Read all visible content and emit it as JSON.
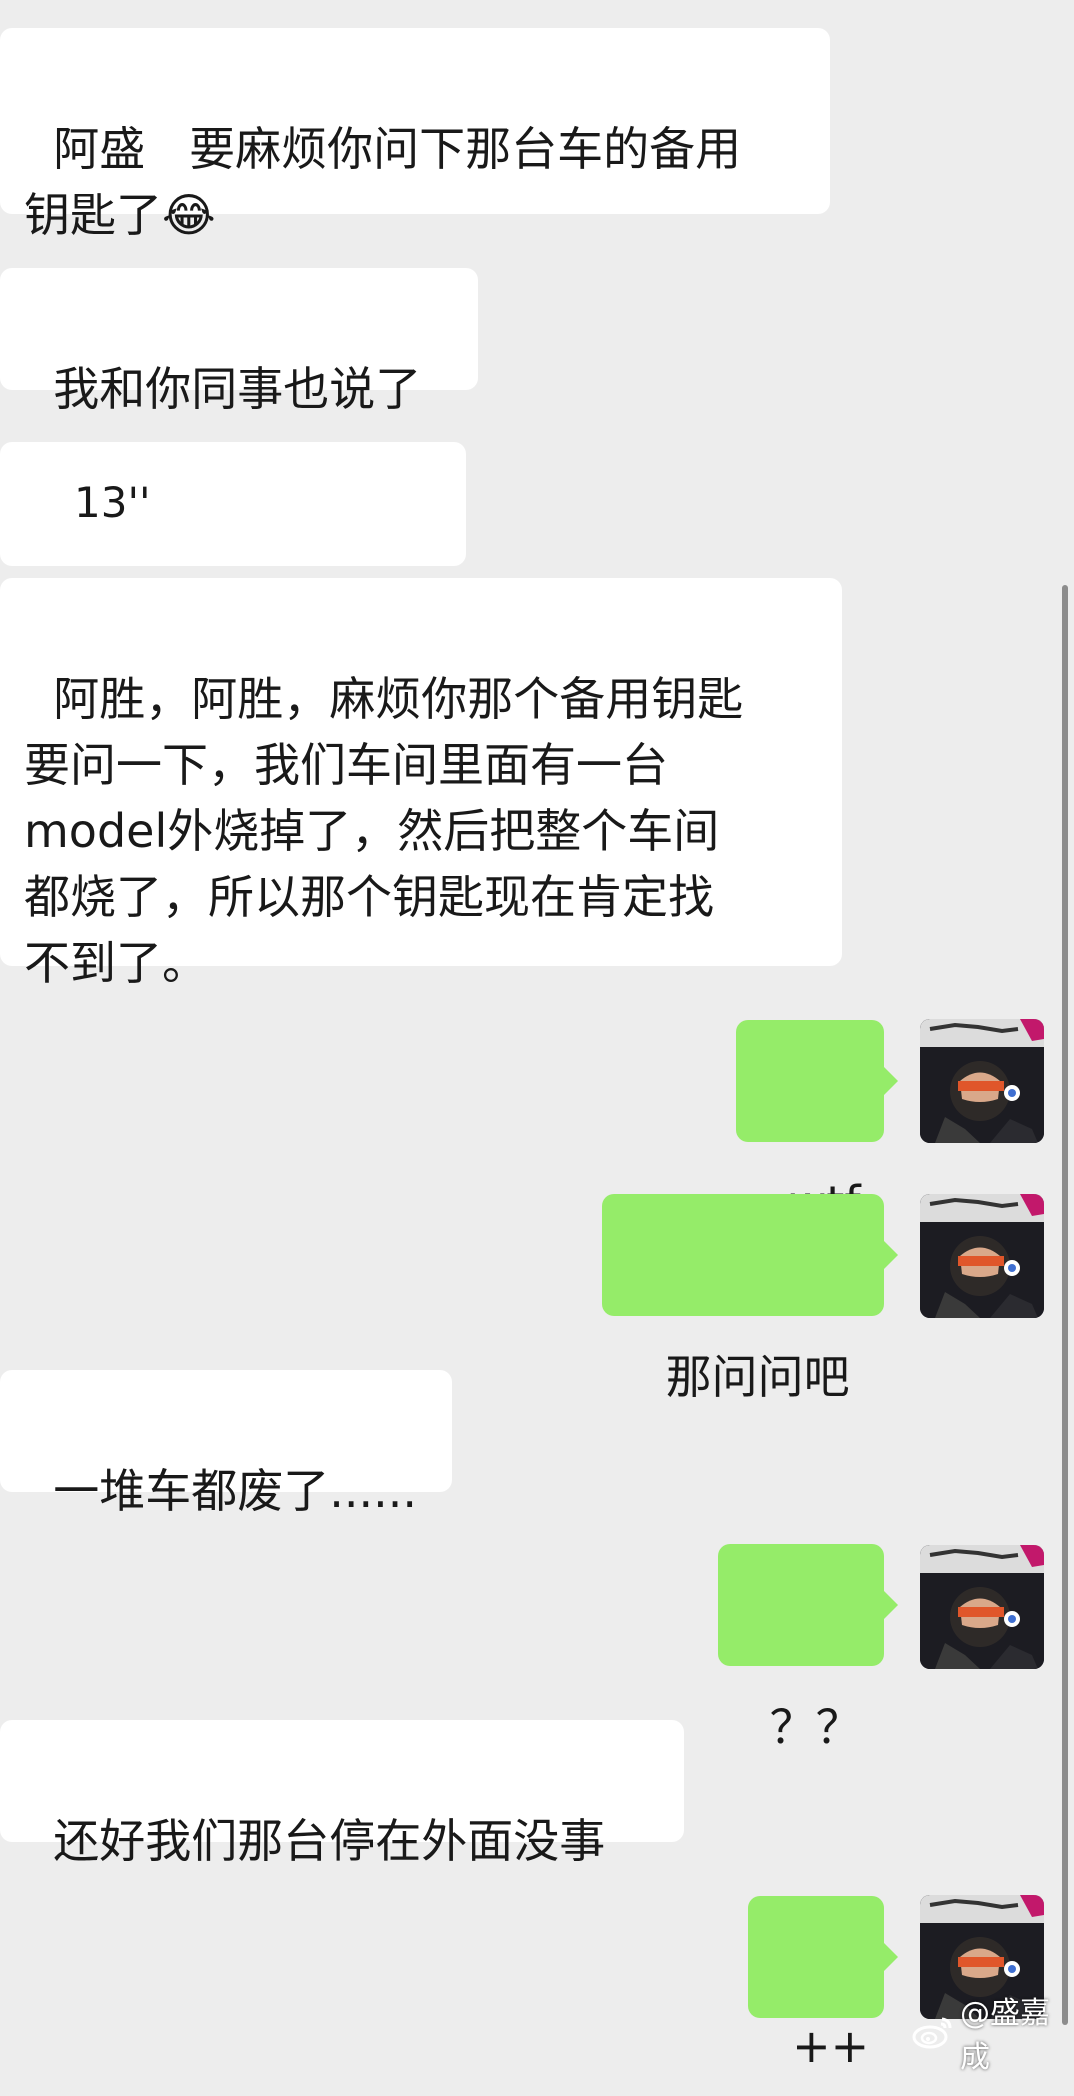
{
  "messages": [
    {
      "side": "left",
      "text": "阿盛   要麻烦你问下那台车的备用\n钥匙了😂"
    },
    {
      "side": "left",
      "text": "我和你同事也说了"
    },
    {
      "side": "left",
      "type": "voice",
      "duration": "13''",
      "icon": "voice-wave-icon"
    },
    {
      "side": "left",
      "text": "阿胜，阿胜，麻烦你那个备用钥匙\n要问一下，我们车间里面有一台\nmodel外烧掉了，然后把整个车间\n都烧了，所以那个钥匙现在肯定找\n不到了。"
    },
    {
      "side": "right",
      "text": "wtf",
      "avatar": "avatar-helmet"
    },
    {
      "side": "right",
      "text": "那问问吧",
      "avatar": "avatar-helmet"
    },
    {
      "side": "left",
      "text": "一堆车都废了......"
    },
    {
      "side": "right",
      "text": "？？",
      "avatar": "avatar-helmet"
    },
    {
      "side": "left",
      "text": "还好我们那台停在外面没事"
    },
    {
      "side": "right",
      "text": "++",
      "avatar": "avatar-helmet"
    }
  ],
  "watermark": {
    "text": "@盛嘉成",
    "icon": "weibo-icon"
  },
  "colors": {
    "background": "#ededed",
    "incoming_bubble": "#ffffff",
    "outgoing_bubble": "#95ec69",
    "text": "#191919"
  }
}
